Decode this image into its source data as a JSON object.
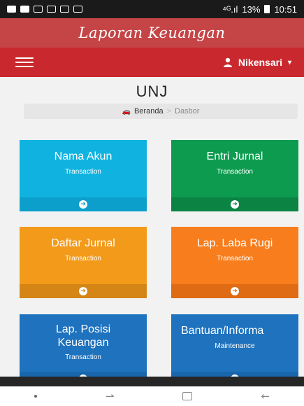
{
  "status": {
    "signal": "⁴ᴳ.ıl",
    "battery": "13%",
    "time": "10:51"
  },
  "app": {
    "title": "Laporan Keuangan"
  },
  "nav": {
    "user": "Nikensari",
    "caret": "▾"
  },
  "page": {
    "org": "UNJ"
  },
  "breadcrumb": {
    "home_icon": "🚗",
    "home": "Beranda",
    "separator": ">",
    "current": "Dasbor"
  },
  "tiles": [
    {
      "title": "Nama Akun",
      "subtitle": "Transaction",
      "color": "#10b3e0",
      "foot": "#0c9fcc"
    },
    {
      "title": "Entri Jurnal",
      "subtitle": "Transaction",
      "color": "#0d9c4f",
      "foot": "#0a8343"
    },
    {
      "title": "Daftar Jurnal",
      "subtitle": "Transaction",
      "color": "#f39a1a",
      "foot": "#d58516"
    },
    {
      "title": "Lap. Laba Rugi",
      "subtitle": "Transaction",
      "color": "#f77d1d",
      "foot": "#df6b14"
    },
    {
      "title": "Lap. Posisi Keuangan",
      "subtitle": "Transaction",
      "color": "#1e72be",
      "foot": "#1966ad"
    },
    {
      "title": "Bantuan/Informa",
      "subtitle": "Maintenance",
      "color": "#1e72be",
      "foot": "#1966ad"
    }
  ],
  "system_nav": {
    "recents": "⇀",
    "back": "←"
  }
}
